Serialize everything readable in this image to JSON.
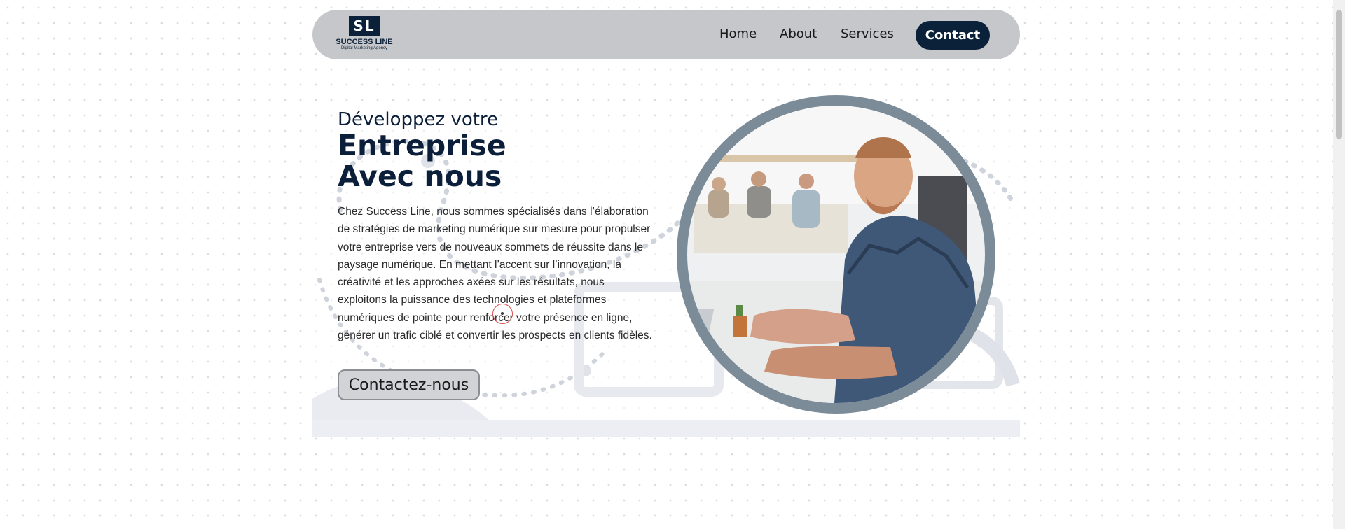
{
  "nav": {
    "logo": {
      "mark": "SL",
      "name": "SUCCESS LINE",
      "tagline": "Digital Marketing Agency"
    },
    "links": [
      "Home",
      "About",
      "Services"
    ],
    "cta": "Contact"
  },
  "hero": {
    "subtitle": "Développez votre",
    "title_line1": "Entreprise",
    "title_line2": "Avec nous",
    "description": "Chez Success Line, nous sommes spécialisés dans l’élaboration de stratégies de marketing numérique sur mesure pour propulser votre entreprise vers de nouveaux sommets de réussite dans le paysage numérique. En mettant l’accent sur l’innovation, la créativité et les approches axées sur les résultats, nous exploitons la puissance des technologies et plateformes numériques de pointe pour renforcer votre présence en ligne, générer un trafic ciblé et convertir les prospects en clients fidèles.",
    "cta": "Contactez-nous"
  },
  "colors": {
    "navy": "#0b2039",
    "navbar_bg": "#c6c7ca",
    "photo_ring": "#7b8b98"
  }
}
